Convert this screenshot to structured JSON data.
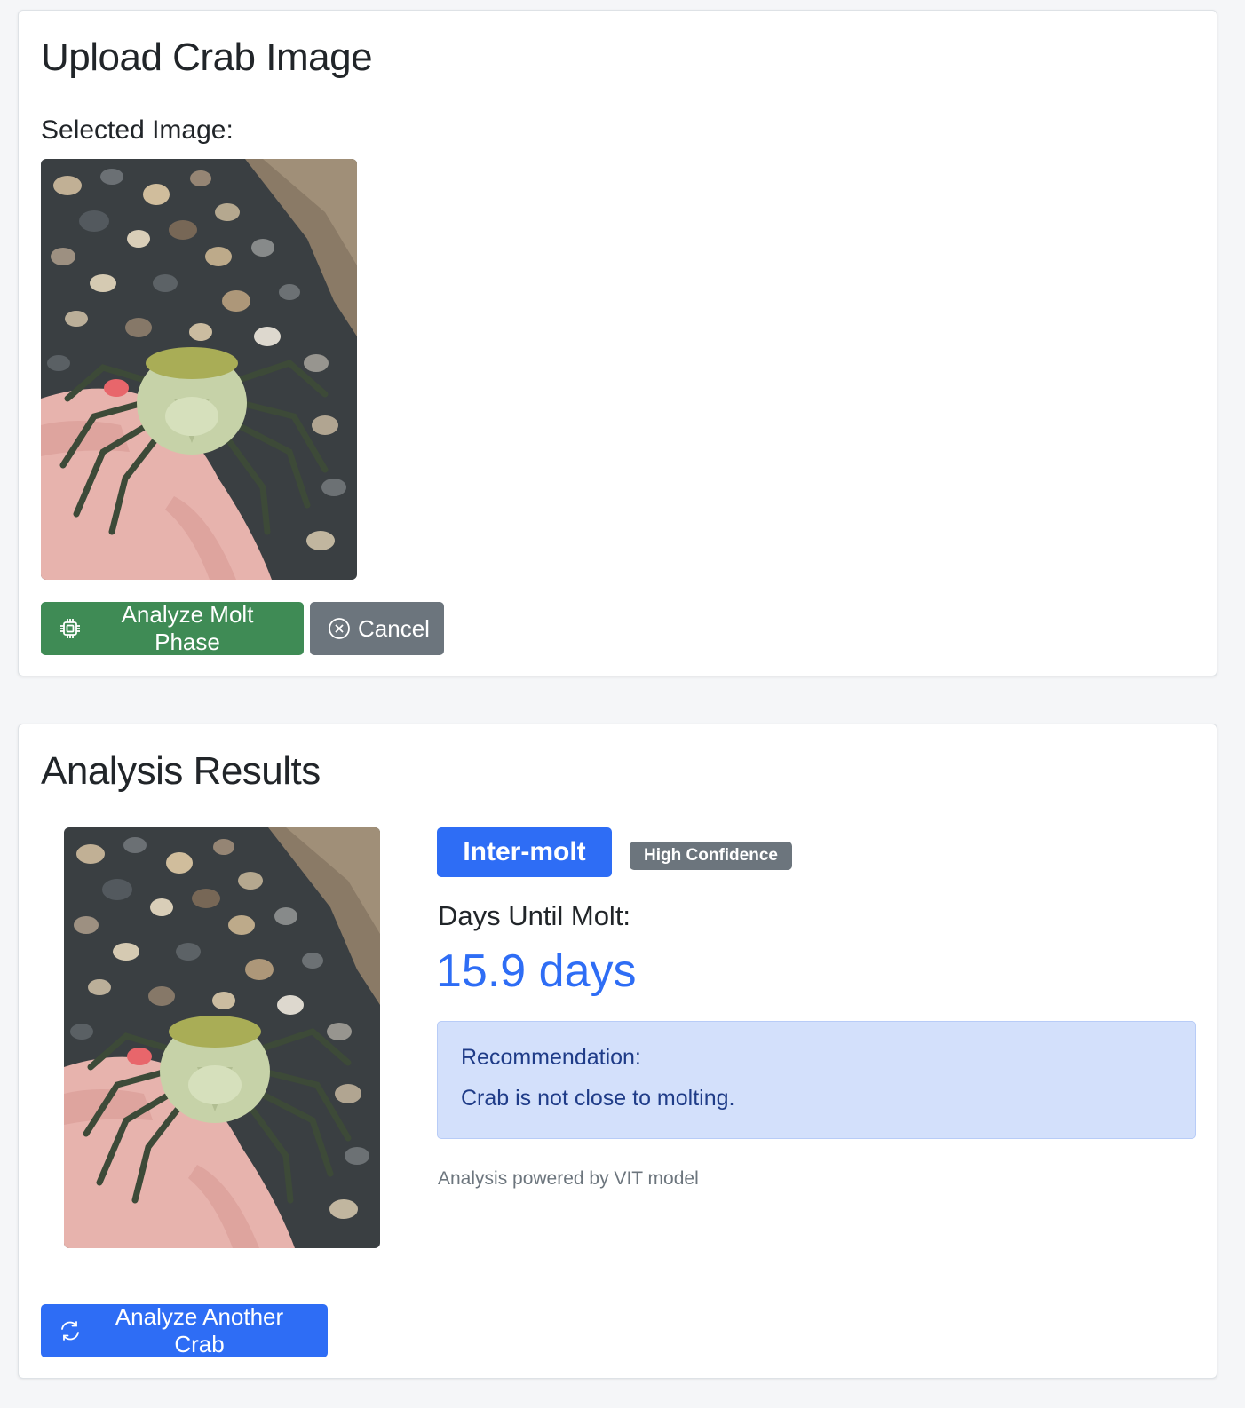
{
  "upload": {
    "title": "Upload Crab Image",
    "selected_label": "Selected Image:",
    "analyze_button": "Analyze Molt Phase",
    "cancel_button": "Cancel"
  },
  "results": {
    "title": "Analysis Results",
    "phase": "Inter-molt",
    "confidence": "High Confidence",
    "days_label": "Days Until Molt:",
    "days_value": "15.9 days",
    "recommendation_title": "Recommendation:",
    "recommendation_text": "Crab is not close to molting.",
    "footnote": "Analysis powered by VIT model",
    "again_button": "Analyze Another Crab"
  },
  "icons": {
    "analyze": "cpu-icon",
    "cancel": "x-circle-icon",
    "again": "refresh-icon"
  },
  "colors": {
    "green": "#3f8b55",
    "gray": "#6c757d",
    "blue": "#2e6df5",
    "recommendation_bg": "#d3e0fb"
  }
}
